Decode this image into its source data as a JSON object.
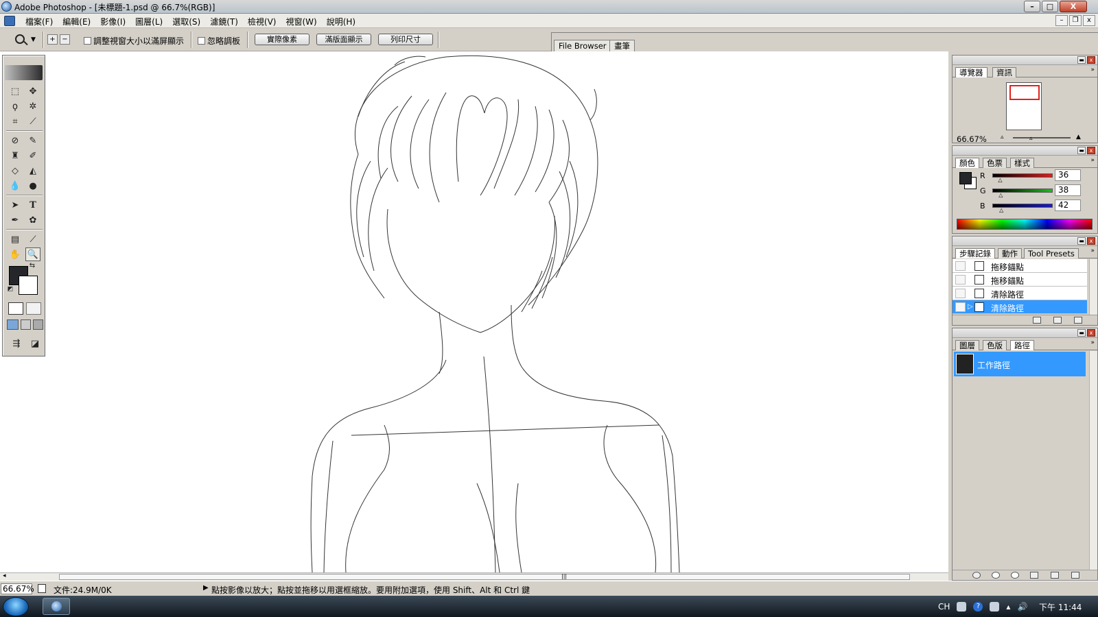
{
  "window": {
    "title": "Adobe Photoshop - [未標題-1.psd @ 66.7%(RGB)]",
    "minimize": "–",
    "maximize": "□",
    "close": "X"
  },
  "menu": {
    "items": [
      "檔案(F)",
      "編輯(E)",
      "影像(I)",
      "圖層(L)",
      "選取(S)",
      "濾鏡(T)",
      "檢視(V)",
      "視窗(W)",
      "說明(H)"
    ],
    "doc_min": "–",
    "doc_restore": "❐",
    "doc_close": "x"
  },
  "options": {
    "zoom_in_glyph": "+",
    "zoom_out_glyph": "−",
    "resize_windows_label": "調整視窗大小以滿屏顯示",
    "ignore_palettes_label": "忽略調板",
    "actual_pixels": "實際像素",
    "fit_on_screen": "滿版面顯示",
    "print_size": "列印尺寸",
    "well_tabs": [
      "File Browser",
      "畫筆"
    ]
  },
  "navigator": {
    "tabs": [
      "導覽器",
      "資訊"
    ],
    "zoom": "66.67%"
  },
  "color": {
    "tabs": [
      "顏色",
      "色票",
      "樣式"
    ],
    "channels": [
      {
        "name": "R",
        "value": "36",
        "ramp": "#e21c1c",
        "fraction": 0.14
      },
      {
        "name": "G",
        "value": "38",
        "ramp": "#1cbf1c",
        "fraction": 0.15
      },
      {
        "name": "B",
        "value": "42",
        "ramp": "#1c1cc8",
        "fraction": 0.16
      }
    ],
    "foreground": "#24262a",
    "background": "#ffffff"
  },
  "history": {
    "tabs": [
      "步驟記錄",
      "動作",
      "Tool Presets"
    ],
    "items": [
      "拖移錨點",
      "拖移錨點",
      "清除路徑",
      "清除路徑"
    ],
    "selected_index": 3
  },
  "paths": {
    "tabs": [
      "圖層",
      "色版",
      "路徑"
    ],
    "items": [
      "工作路徑"
    ]
  },
  "status": {
    "zoom": "66.67%",
    "doc": "文件:24.9M/0K",
    "hint": "點按影像以放大；點按並拖移以用選框縮放。要用附加選項，使用 Shift、Alt 和 Ctrl 鍵"
  },
  "taskbar": {
    "lang": "CH",
    "help": "?",
    "clock": "下午 11:44"
  },
  "colors": {
    "selection": "#3399ff",
    "nav_view_box": "#e0201c"
  }
}
